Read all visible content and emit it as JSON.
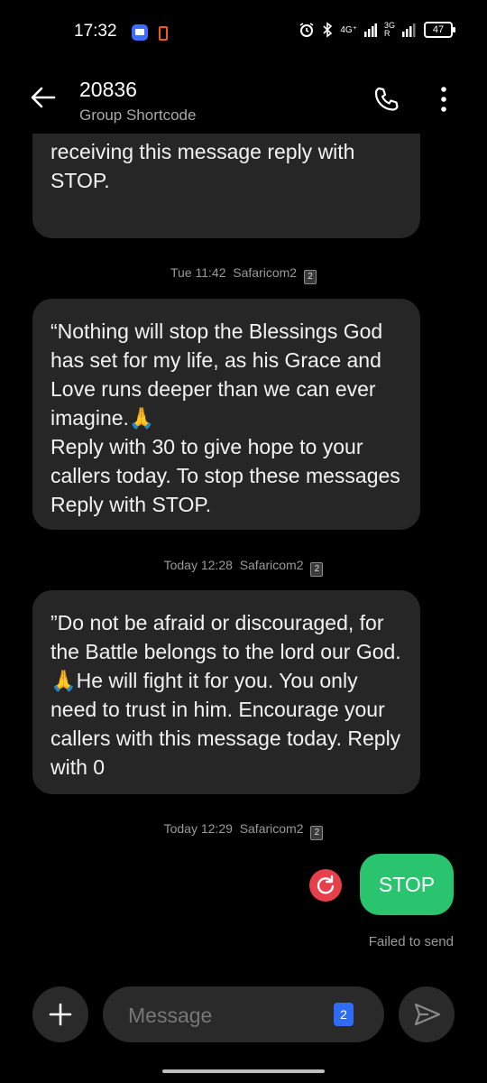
{
  "status_bar": {
    "time": "17:32",
    "network_4g": "4G⁺",
    "network_3g": "3G",
    "roaming": "R",
    "battery": "47"
  },
  "header": {
    "title": "20836",
    "subtitle": "Group Shortcode"
  },
  "messages": [
    {
      "text": "receiving this message reply with STOP."
    },
    {
      "meta_time": "Tue 11:42",
      "meta_sim": "Safaricom2",
      "sim_num": "2",
      "text": "“Nothing will stop the Blessings God has set for my life, as his Grace and Love runs deeper than we can ever imagine.🙏\nReply with 30 to give hope to your callers today. To stop these messages Reply with STOP."
    },
    {
      "meta_time": "Today 12:28",
      "meta_sim": "Safaricom2",
      "sim_num": "2",
      "text": "”Do not be afraid or discouraged, for the Battle belongs to the lord our God.🙏He will fight it for you. You only need to trust in him. Encourage your callers with this message today. Reply with 0"
    }
  ],
  "outgoing": {
    "meta_time": "Today 12:29",
    "meta_sim": "Safaricom2",
    "sim_num": "2",
    "text": "STOP",
    "status": "Failed to send"
  },
  "composer": {
    "placeholder": "Message",
    "sim_slot": "2"
  },
  "colors": {
    "background": "#000000",
    "bubble_in": "#262626",
    "bubble_out": "#2ac46e",
    "error": "#e8404a",
    "sim_badge": "#2f6cf6"
  }
}
